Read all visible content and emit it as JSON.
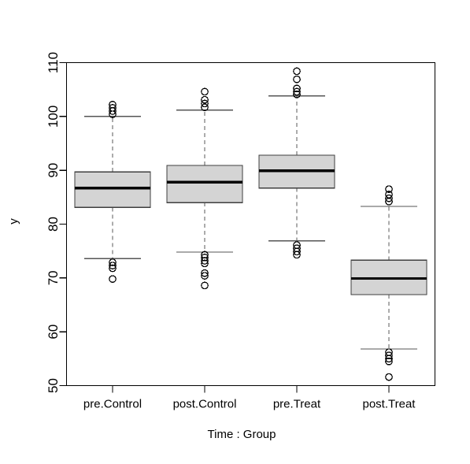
{
  "chart_data": {
    "type": "box",
    "title": "",
    "xlabel": "Time : Group",
    "ylabel": "y",
    "categories": [
      "pre.Control",
      "post.Control",
      "pre.Treat",
      "post.Treat"
    ],
    "ylim": [
      50,
      110
    ],
    "yticks": [
      50,
      60,
      70,
      80,
      90,
      100,
      110
    ],
    "ytick_labels": [
      "50",
      "60",
      "70",
      "80",
      "90",
      "100",
      "110"
    ],
    "grid": false,
    "legend": "none",
    "boxes": [
      {
        "category": "pre.Control",
        "lower_whisker": 73.6,
        "q1": 83.1,
        "median": 86.7,
        "q3": 89.7,
        "upper_whisker": 100.0,
        "outliers_high": [
          102.2,
          101.6,
          101.0,
          100.4
        ],
        "outliers_low": [
          72.9,
          72.3,
          71.8,
          69.8
        ]
      },
      {
        "category": "post.Control",
        "lower_whisker": 74.8,
        "q1": 84.0,
        "median": 87.8,
        "q3": 90.9,
        "upper_whisker": 101.2,
        "outliers_high": [
          104.6,
          103.1,
          102.4,
          101.7
        ],
        "outliers_low": [
          74.3,
          73.8,
          73.2,
          72.7,
          70.9,
          70.4,
          68.6
        ]
      },
      {
        "category": "pre.Treat",
        "lower_whisker": 76.9,
        "q1": 86.7,
        "median": 89.9,
        "q3": 92.8,
        "upper_whisker": 103.8,
        "outliers_high": [
          108.4,
          106.9,
          105.2,
          104.6,
          104.1
        ],
        "outliers_low": [
          76.1,
          75.5,
          74.9,
          74.3
        ]
      },
      {
        "category": "post.Treat",
        "lower_whisker": 56.8,
        "q1": 66.9,
        "median": 69.9,
        "q3": 73.3,
        "upper_whisker": 83.3,
        "outliers_high": [
          86.5,
          85.5,
          84.8,
          84.2
        ],
        "outliers_low": [
          56.2,
          55.6,
          55.0,
          54.5,
          51.6
        ]
      }
    ],
    "colors": {
      "box_fill": "#d4d4d4",
      "box_border": "#3f3f3f",
      "median": "#000000",
      "whisker": "#5a5a5a",
      "axis": "#000000"
    }
  }
}
